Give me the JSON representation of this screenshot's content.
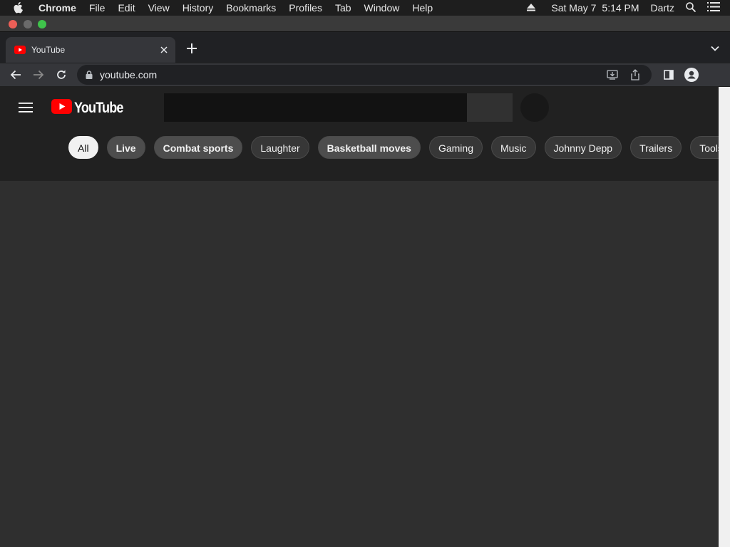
{
  "menubar": {
    "app": "Chrome",
    "items": [
      "File",
      "Edit",
      "View",
      "History",
      "Bookmarks",
      "Profiles",
      "Tab",
      "Window",
      "Help"
    ],
    "date": "Sat May 7",
    "time": "5:14 PM",
    "user": "Dartz"
  },
  "tab": {
    "title": "YouTube"
  },
  "address": {
    "url": "youtube.com"
  },
  "youtube": {
    "brand": "YouTube",
    "chips": [
      "All",
      "Live",
      "Combat sports",
      "Laughter",
      "Basketball moves",
      "Gaming",
      "Music",
      "Johnny Depp",
      "Trailers",
      "Tools"
    ]
  },
  "colors": {
    "youtube_red": "#ff0000",
    "chip_active_bg": "#f1f1f1",
    "page_bg": "#2f2f2f"
  }
}
